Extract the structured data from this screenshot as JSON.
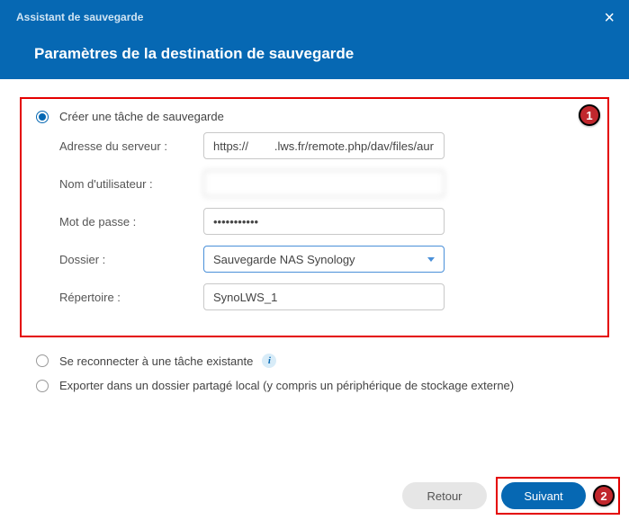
{
  "header": {
    "assistant_title": "Assistant de sauvegarde",
    "page_title": "Paramètres de la destination de sauvegarde",
    "close_glyph": "×"
  },
  "options": {
    "create": {
      "label": "Créer une tâche de sauvegarde",
      "selected": true,
      "fields": {
        "server_label": "Adresse du serveur :",
        "server_value": "https://        .lws.fr/remote.php/dav/files/aur",
        "user_label": "Nom d'utilisateur :",
        "user_value": "",
        "pass_label": "Mot de passe :",
        "pass_value": "•••••••••••",
        "folder_label": "Dossier :",
        "folder_value": "Sauvegarde NAS Synology",
        "dir_label": "Répertoire :",
        "dir_value": "SynoLWS_1"
      }
    },
    "reconnect": {
      "label": "Se reconnecter à une tâche existante"
    },
    "export": {
      "label": "Exporter dans un dossier partagé local (y compris un périphérique de stockage externe)"
    }
  },
  "footer": {
    "back": "Retour",
    "next": "Suivant"
  },
  "annotations": {
    "badge1": "1",
    "badge2": "2",
    "info_glyph": "i"
  }
}
